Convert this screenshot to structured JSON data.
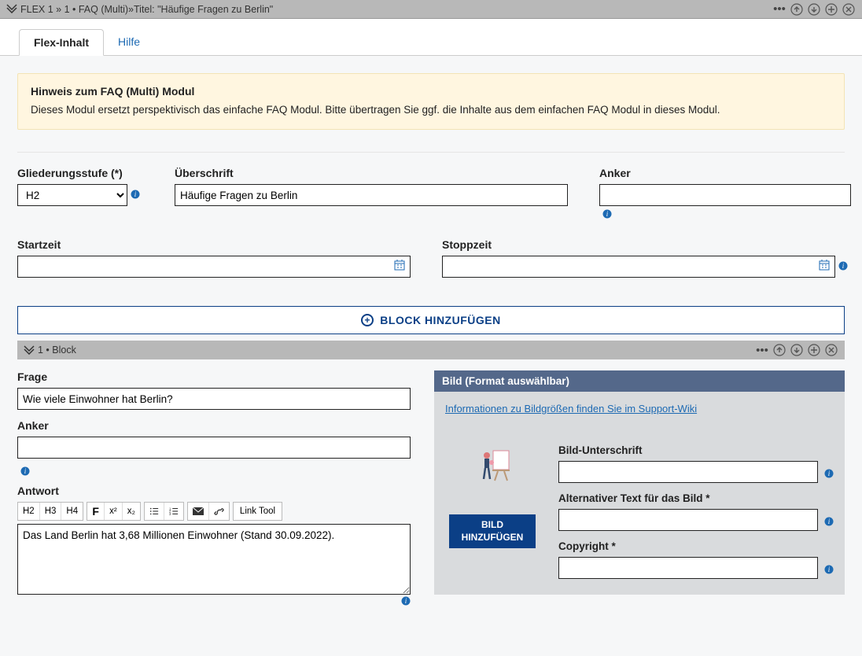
{
  "header": {
    "path_prefix": "FLEX 1 »  1 • FAQ (Multi)»Titel: \"Häufige Fragen zu Berlin\"",
    "icons": [
      "more",
      "up",
      "down",
      "add",
      "close"
    ]
  },
  "tabs": {
    "active": "Flex-Inhalt",
    "inactive": "Hilfe"
  },
  "hint": {
    "title": "Hinweis zum FAQ (Multi) Modul",
    "text": "Dieses Modul ersetzt perspektivisch das einfache FAQ Modul. Bitte übertragen Sie ggf. die Inhalte aus dem einfachen FAQ Modul in dieses Modul."
  },
  "form": {
    "gliederungsstufe_label": "Gliederungsstufe (*)",
    "gliederungsstufe_value": "H2",
    "ueberschrift_label": "Überschrift",
    "ueberschrift_value": "Häufige Fragen zu Berlin",
    "anker_label": "Anker",
    "anker_value": "",
    "startzeit_label": "Startzeit",
    "startzeit_value": "",
    "stopzeit_label": "Stoppzeit",
    "stopzeit_value": ""
  },
  "block_add_label": "BLOCK HINZUFÜGEN",
  "block_header": {
    "title": "1 • Block"
  },
  "block": {
    "frage_label": "Frage",
    "frage_value": "Wie viele Einwohner hat Berlin?",
    "anker_label": "Anker",
    "anker_value": "",
    "antwort_label": "Antwort",
    "antwort_value": "Das Land Berlin hat 3,68 Millionen Einwohner (Stand 30.09.2022).",
    "toolbar": {
      "h2": "H2",
      "h3": "H3",
      "h4": "H4",
      "bold": "F",
      "sup": "x²",
      "sub": "x₂",
      "ul": "ul",
      "ol": "ol",
      "mail": "mail",
      "link": "link",
      "link_tool": "Link Tool"
    }
  },
  "bild": {
    "panel_title": "Bild (Format auswählbar)",
    "info_link": "Informationen zu Bildgrößen finden Sie im Support-Wiki",
    "add_btn": "BILD HINZUFÜGEN",
    "caption_label": "Bild-Unterschrift",
    "caption_value": "",
    "alt_label": "Alternativer Text für das Bild *",
    "alt_value": "",
    "copyright_label": "Copyright *",
    "copyright_value": ""
  }
}
